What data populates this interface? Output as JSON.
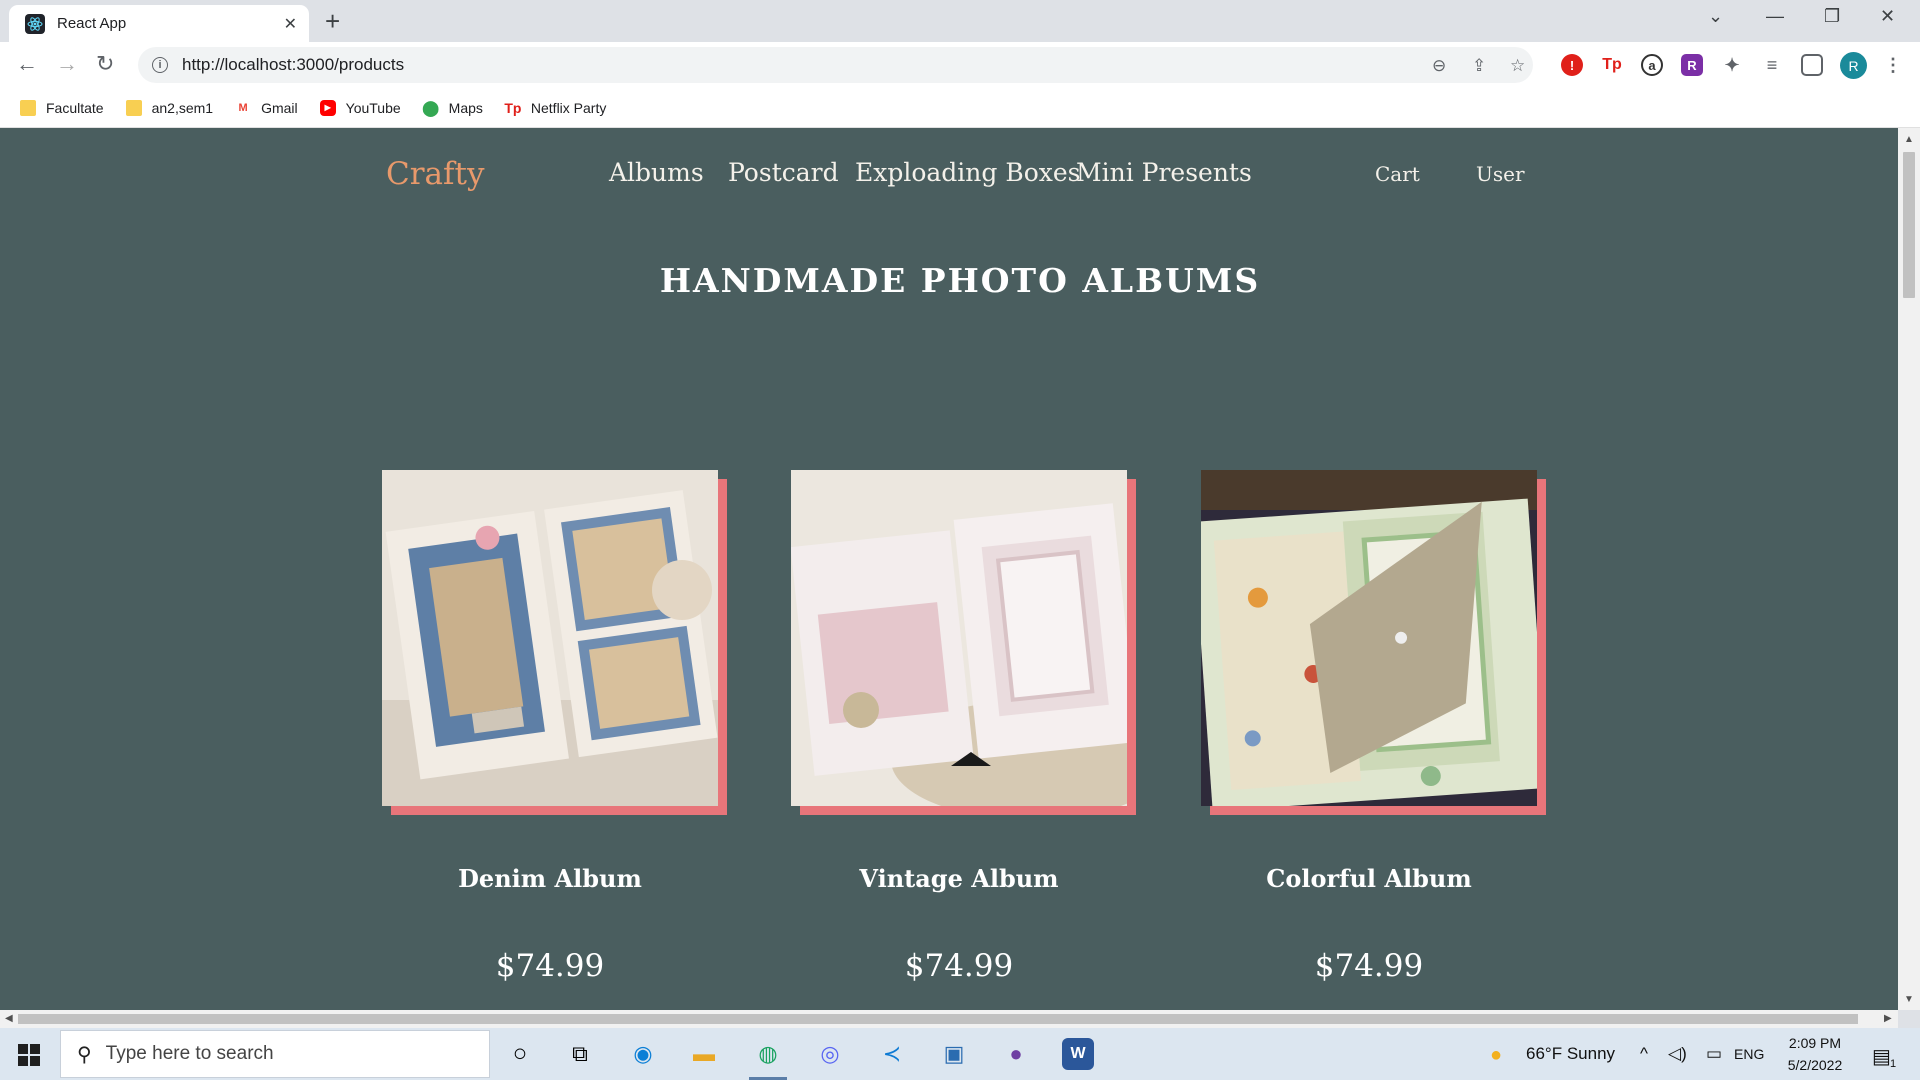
{
  "browser": {
    "tab_title": "React App",
    "tab_close": "✕",
    "new_tab": "+",
    "url": "http://localhost:3000/products",
    "win_controls": {
      "tabsearch": "⌄",
      "minimize": "—",
      "restore": "❐",
      "close": "✕"
    },
    "nav": {
      "back": "←",
      "forward": "→",
      "reload": "↻"
    },
    "bookmarks": [
      {
        "label": "Facultate",
        "icon": "folder-icon"
      },
      {
        "label": "an2,sem1",
        "icon": "folder-icon"
      },
      {
        "label": "Gmail",
        "icon": "gmail-icon"
      },
      {
        "label": "YouTube",
        "icon": "youtube-icon"
      },
      {
        "label": "Maps",
        "icon": "maps-icon"
      },
      {
        "label": "Netflix Party",
        "icon": "netflix-party-icon"
      }
    ],
    "profile_initial": "R"
  },
  "site": {
    "logo": "Crafty",
    "nav": [
      "Albums",
      "Postcard",
      "Exploading Boxes",
      "Mini Presents"
    ],
    "cart": "Cart",
    "user": "User",
    "page_title": "HANDMADE PHOTO ALBUMS",
    "products": [
      {
        "name": "Denim Album",
        "price": "$74.99"
      },
      {
        "name": "Vintage Album",
        "price": "$74.99"
      },
      {
        "name": "Colorful Album",
        "price": "$74.99"
      }
    ],
    "colors": {
      "background": "#4a5e5f",
      "logo": "#e8996b",
      "accent_shadow": "#e8757a"
    }
  },
  "taskbar": {
    "search_placeholder": "Type here to search",
    "weather": "66°F  Sunny",
    "language": "ENG",
    "time": "2:09 PM",
    "date": "5/2/2022",
    "notifications": "1"
  }
}
